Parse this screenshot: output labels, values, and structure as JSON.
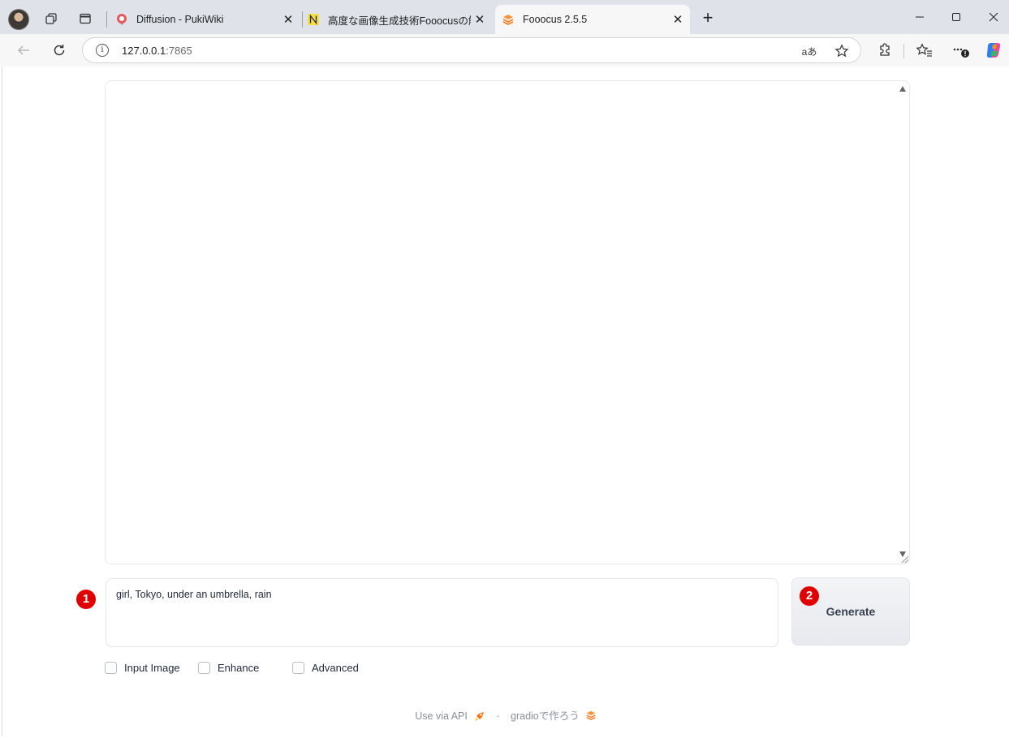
{
  "browser": {
    "tabs": [
      {
        "title": "Diffusion - PukiWiki",
        "favicon": "pukiwiki-icon",
        "active": false
      },
      {
        "title": "高度な画像生成技術Fooocusの解説",
        "favicon": "notion-icon",
        "active": false
      },
      {
        "title": "Fooocus 2.5.5",
        "favicon": "fooocus-icon",
        "active": true
      }
    ],
    "close_glyph": "✕",
    "new_tab_glyph": "+",
    "address": {
      "host": "127.0.0.1",
      "port": ":7865"
    },
    "read_aloud_label": "aあ"
  },
  "app": {
    "prompt": {
      "value": "girl, Tokyo, under an umbrella, rain"
    },
    "generate_label": "Generate",
    "options": [
      {
        "label": "Input Image",
        "checked": false
      },
      {
        "label": "Enhance",
        "checked": false
      },
      {
        "label": "Advanced",
        "checked": false
      }
    ],
    "footer": {
      "api_label": "Use via API",
      "separator": "·",
      "built_with": "gradioで作ろう"
    }
  },
  "annotations": [
    {
      "number": "1"
    },
    {
      "number": "2"
    }
  ],
  "colors": {
    "badge": "#e00000",
    "tab_strip": "#dfe2e8",
    "accent_orange": "#f97316"
  }
}
